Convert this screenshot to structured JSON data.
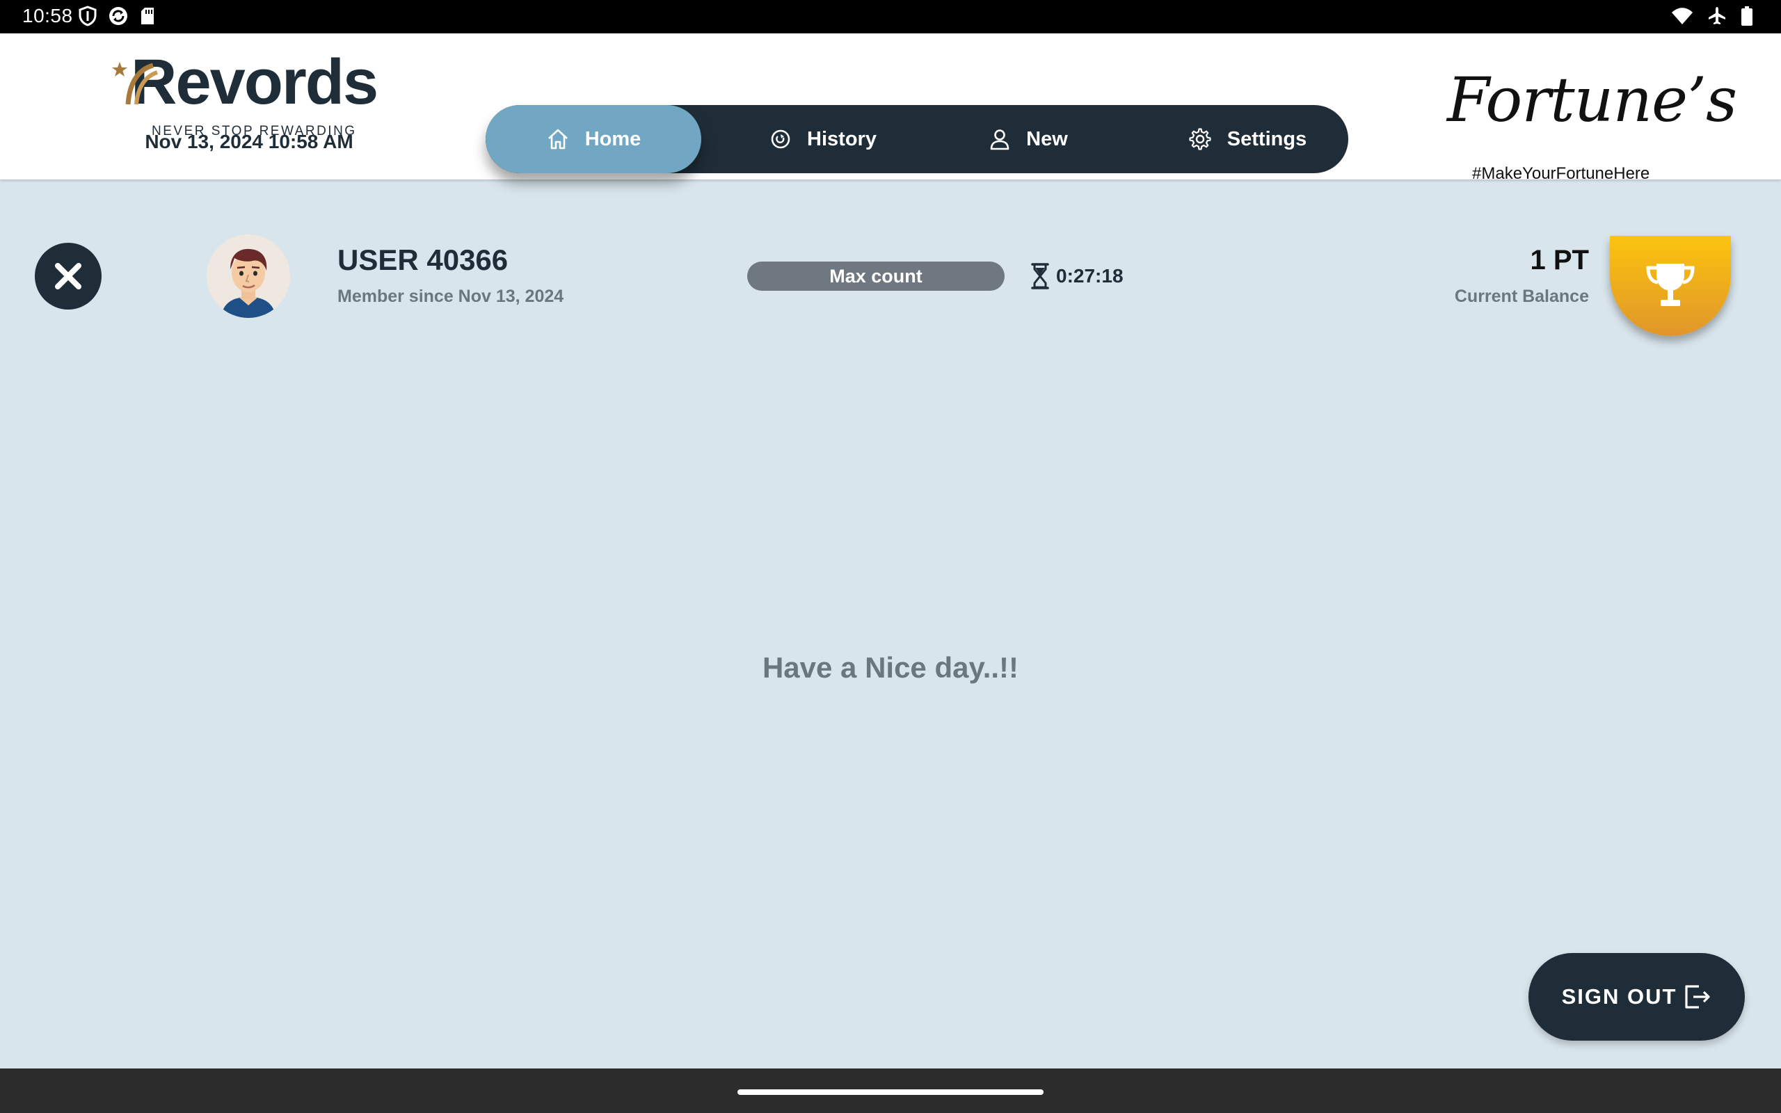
{
  "status_bar": {
    "time": "10:58",
    "left_icons": [
      "shield-icon",
      "sync-icon",
      "sd-card-icon"
    ],
    "right_icons": [
      "wifi-icon",
      "airplane-icon",
      "battery-icon"
    ]
  },
  "header": {
    "brand": {
      "name": "Revords",
      "tagline": "NEVER STOP REWARDING",
      "colors": {
        "dark": "#1f2d38",
        "accent": "#a8793a"
      }
    },
    "datetime": "Nov 13, 2024 10:58 AM",
    "nav": [
      {
        "label": "Home",
        "icon": "home-icon",
        "active": true
      },
      {
        "label": "History",
        "icon": "history-icon",
        "active": false
      },
      {
        "label": "New",
        "icon": "user-icon",
        "active": false
      },
      {
        "label": "Settings",
        "icon": "gear-icon",
        "active": false
      }
    ],
    "partner": {
      "name": "Fortune’s",
      "tagline": "#MakeYourFortuneHere"
    }
  },
  "member": {
    "name": "USER 40366",
    "member_since": "Member since Nov 13, 2024",
    "status_badge": "Max count",
    "timer": "0:27:18",
    "balance": "1 PT",
    "balance_label": "Current Balance"
  },
  "main": {
    "message": "Have a Nice day..!!"
  },
  "actions": {
    "sign_out": "SIGN OUT"
  },
  "theme": {
    "background": "#d8e5ec",
    "nav_dark": "#1f2d38",
    "nav_active": "#72a7c3",
    "badge": "#6f7780",
    "trophy_top": "#fbc40e",
    "trophy_bottom": "#e0962a"
  }
}
